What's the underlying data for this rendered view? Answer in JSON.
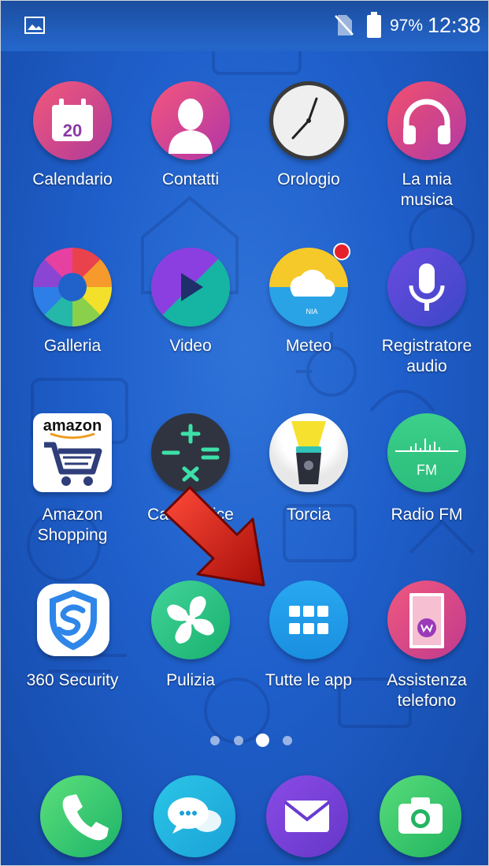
{
  "status_bar": {
    "battery_percent": "97%",
    "time": "12:38",
    "notification_icon": "image-icon",
    "signal_icon": "no-sim-icon",
    "battery_icon": "battery-icon"
  },
  "apps": [
    {
      "label": "Calendario",
      "icon": "calendar-icon",
      "calendar_day": "20"
    },
    {
      "label": "Contatti",
      "icon": "contacts-icon"
    },
    {
      "label": "Orologio",
      "icon": "clock-icon"
    },
    {
      "label": "La mia\nmusica",
      "icon": "headphones-icon"
    },
    {
      "label": "Galleria",
      "icon": "gallery-icon"
    },
    {
      "label": "Video",
      "icon": "video-play-icon"
    },
    {
      "label": "Meteo",
      "icon": "weather-icon",
      "badge_color": "#e5202a",
      "brand_text": "NIA"
    },
    {
      "label": "Registratore\naudio",
      "icon": "microphone-icon"
    },
    {
      "label": "Amazon\nShopping",
      "icon": "amazon-cart-icon",
      "brand_text": "amazon"
    },
    {
      "label": "Calcolatrice",
      "icon": "calculator-icon"
    },
    {
      "label": "Torcia",
      "icon": "flashlight-icon"
    },
    {
      "label": "Radio FM",
      "icon": "radio-fm-icon",
      "brand_text": "FM"
    },
    {
      "label": "360 Security",
      "icon": "security-shield-icon"
    },
    {
      "label": "Pulizia",
      "icon": "fan-cleaner-icon"
    },
    {
      "label": "Tutte le app",
      "icon": "app-grid-icon"
    },
    {
      "label": "Assistenza\ntelefono",
      "icon": "support-phone-icon"
    }
  ],
  "page_indicator": {
    "count": 4,
    "active_index": 2
  },
  "dock": [
    {
      "name": "phone-icon"
    },
    {
      "name": "messages-icon"
    },
    {
      "name": "email-icon"
    },
    {
      "name": "camera-icon"
    }
  ],
  "overlay": {
    "icon": "red-arrow-pointer-icon",
    "color": "#d41a12"
  }
}
